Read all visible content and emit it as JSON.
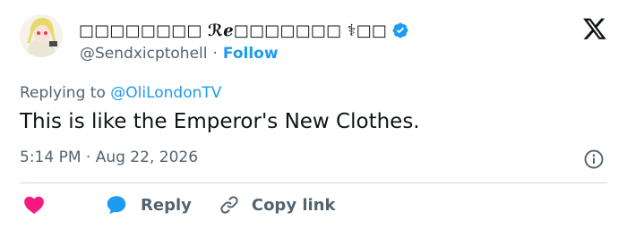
{
  "author": {
    "display_name": "□□□□□□□□ ℛℯ□□□□□□□ ⚕□□",
    "handle": "@Sendxicptohell",
    "separator": "·",
    "follow_label": "Follow",
    "verified": true
  },
  "tweet": {
    "replying_prefix": "Replying to",
    "replying_to": "@OliLondonTV",
    "text": "This is like the Emperor's New Clothes.",
    "timestamp": "5:14 PM · Aug 22, 2026"
  },
  "actions": {
    "reply_label": "Reply",
    "copy_link_label": "Copy link"
  },
  "colors": {
    "accent": "#1d9bf0",
    "heart": "#f91880",
    "muted": "#536471",
    "text": "#0f1419"
  },
  "icons": {
    "logo": "x-logo-icon",
    "verified": "verified-badge-icon",
    "info": "info-icon",
    "like": "heart-icon",
    "reply": "speech-bubble-icon",
    "copy_link": "link-icon"
  }
}
